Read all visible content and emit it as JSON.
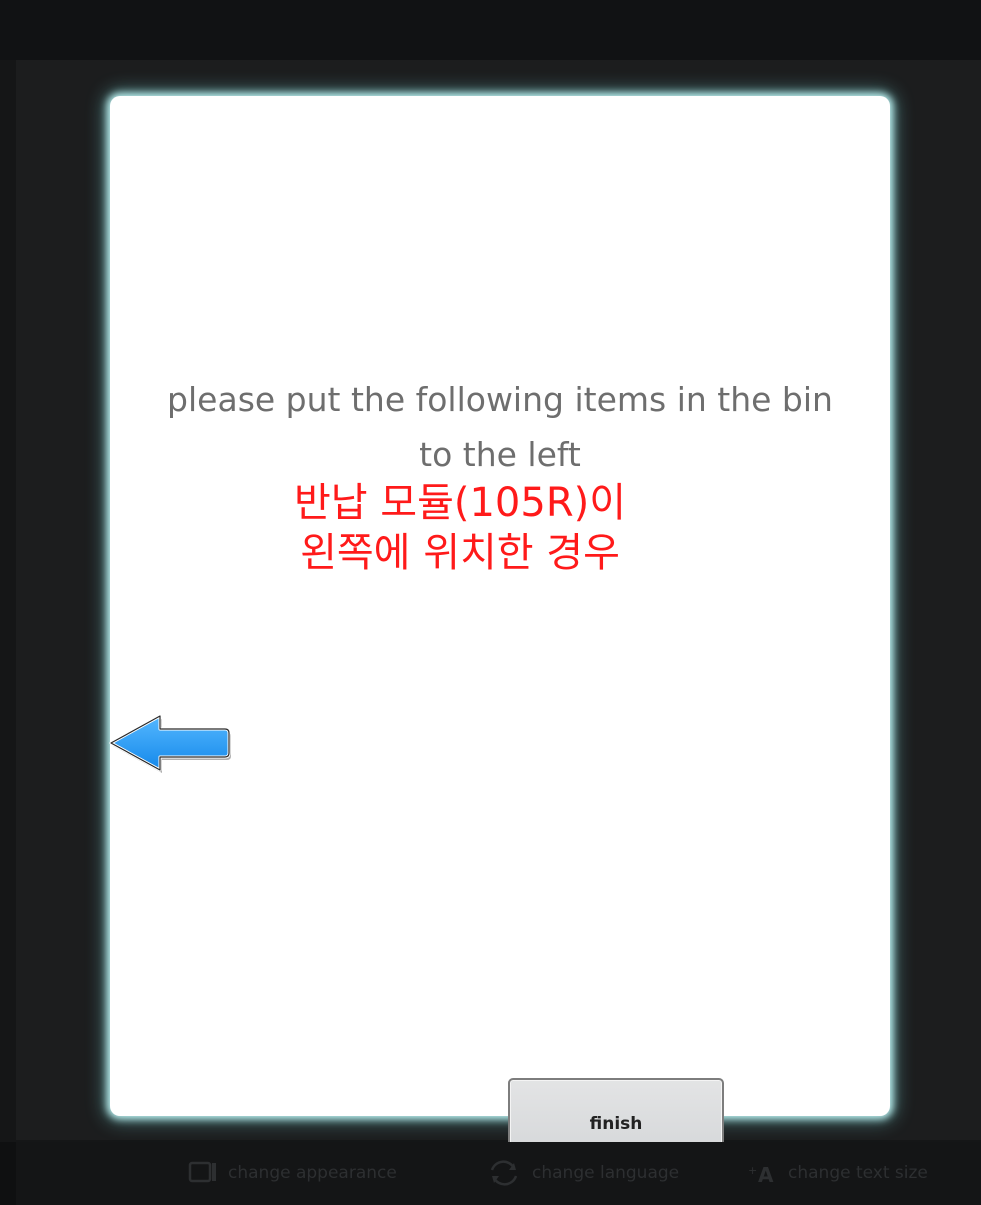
{
  "dialog": {
    "prompt_line1": "please put the following items in the bin",
    "prompt_line2": "to the left",
    "finish_label": "finish"
  },
  "annotation": {
    "line1": "반납 모듈(105R)이",
    "line2": "왼쪽에 위치한 경우",
    "color": "#ff1a1a"
  },
  "arrow": {
    "icon": "left-arrow-icon",
    "color": "#2b9af3"
  },
  "footer": {
    "items": [
      {
        "icon": "appearance-icon",
        "label": "change appearance"
      },
      {
        "icon": "language-icon",
        "label": "change language"
      },
      {
        "icon": "text-size-icon",
        "label": "change text size"
      }
    ]
  },
  "colors": {
    "background": "#151617",
    "modal": "#ffffff",
    "modal_glow": "#bff3f3",
    "button": "#d8dadc"
  }
}
